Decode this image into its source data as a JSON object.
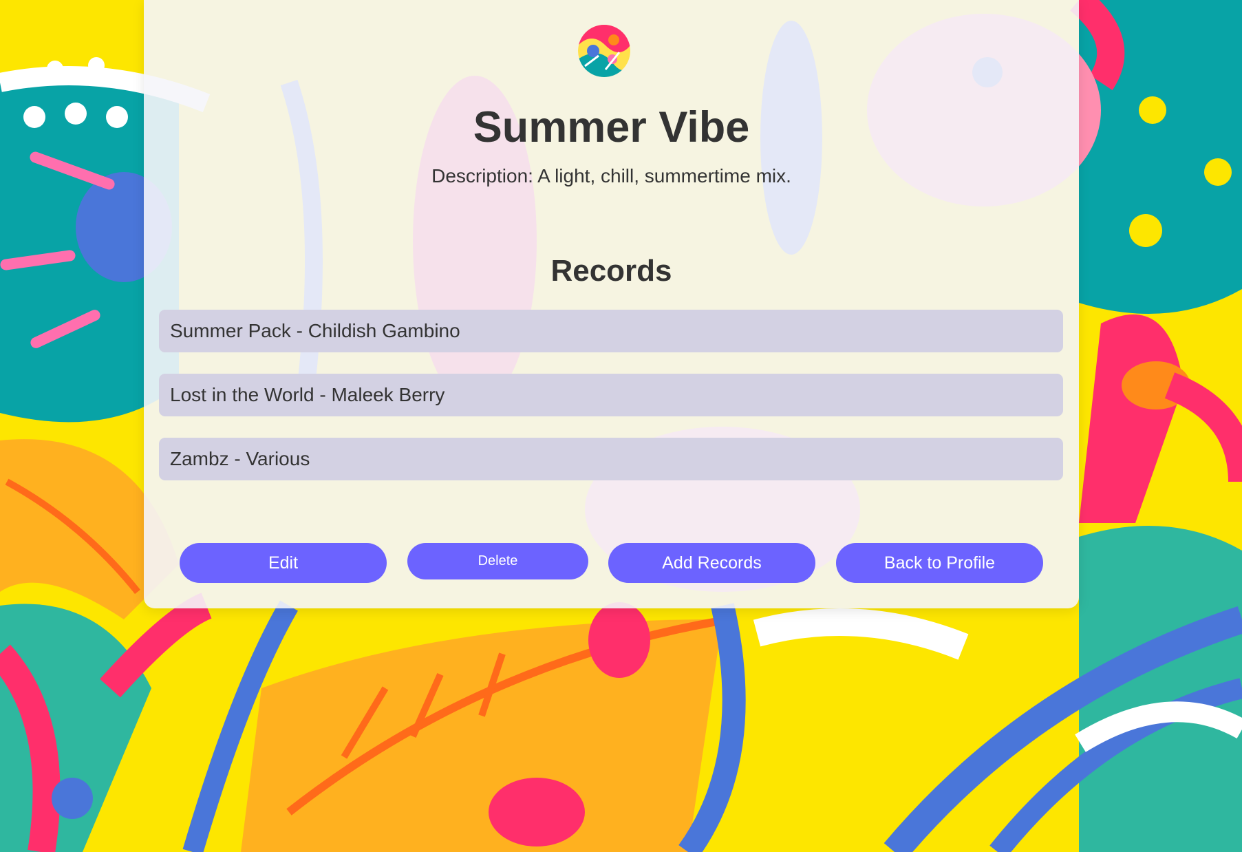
{
  "playlist": {
    "title": "Summer Vibe",
    "description": "Description: A light, chill, summertime mix."
  },
  "records": {
    "heading": "Records",
    "items": [
      {
        "label": "Summer Pack - Childish Gambino"
      },
      {
        "label": "Lost in the World - Maleek Berry"
      },
      {
        "label": "Zambz - Various"
      }
    ]
  },
  "actions": {
    "edit_label": "Edit",
    "delete_label": "Delete",
    "add_records_label": "Add Records",
    "back_label": "Back to Profile"
  },
  "colors": {
    "button": "#6c63ff",
    "record_bg": "#d3d1e3",
    "text": "#333333",
    "background_yellow": "#fde600"
  }
}
